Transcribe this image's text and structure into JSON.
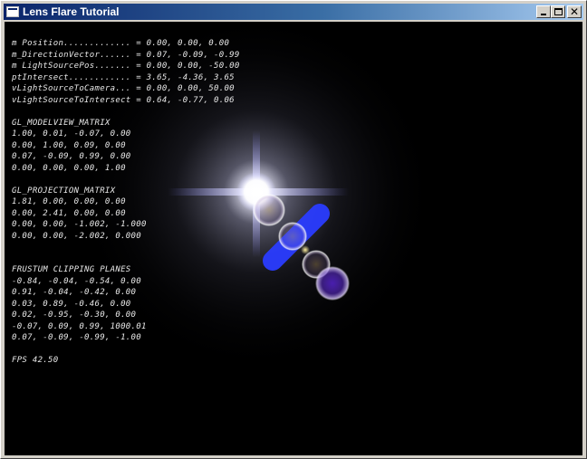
{
  "window": {
    "title": "Lens Flare Tutorial",
    "controls": {
      "minimize": "minimize",
      "maximize": "maximize",
      "close": "close"
    }
  },
  "colors": {
    "titlebar_start": "#0a246a",
    "titlebar_end": "#a6caf0",
    "viewport_background": "#000000",
    "text": "#e8e8e8",
    "flare_blue": "#2a3cff"
  },
  "hud": {
    "lines": [
      "m Position............. = 0.00, 0.00, 0.00",
      "m_DirectionVector...... = 0.07, -0.09, -0.99",
      "m LightSourcePos....... = 0.00, 0.00, -50.00",
      "ptIntersect............ = 3.65, -4.36, 3.65",
      "vLightSourceToCamera... = 0.00, 0.00, 50.00",
      "vLightSourceToIntersect = 0.64, -0.77, 0.06",
      "",
      "GL_MODELVIEW_MATRIX",
      "1.00, 0.01, -0.07, 0.00",
      "0.00, 1.00, 0.09, 0.00",
      "0.07, -0.09, 0.99, 0.00",
      "0.00, 0.00, 0.00, 1.00",
      "",
      "GL_PROJECTION_MATRIX",
      "1.81, 0.00, 0.00, 0.00",
      "0.00, 2.41, 0.00, 0.00",
      "0.00, 0.00, -1.002, -1.000",
      "0.00, 0.00, -2.002, 0.000",
      "",
      "",
      "FRUSTUM CLIPPING PLANES",
      "-0.84, -0.04, -0.54, 0.00",
      "0.91, -0.04, -0.42, 0.00",
      "0.03, 0.89, -0.46, 0.00",
      "0.02, -0.95, -0.30, 0.00",
      "-0.07, 0.09, 0.99, 1000.01",
      "0.07, -0.09, -0.99, -1.00",
      "",
      "FPS 42.50"
    ]
  }
}
